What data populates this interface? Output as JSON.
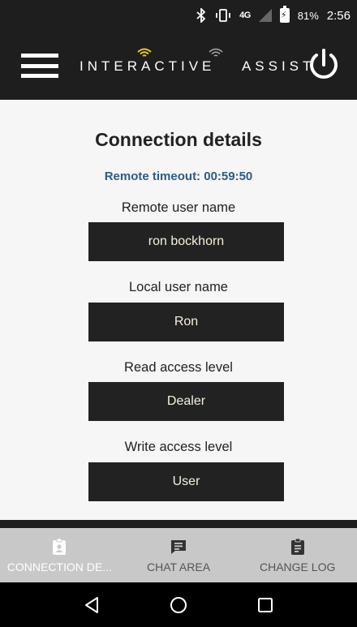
{
  "status_bar": {
    "network": "4G",
    "battery": "81%",
    "time": "2:56"
  },
  "app_bar": {
    "brand_left": "INTERACTIVE",
    "brand_right": "ASSIST",
    "menu_icon": "hamburger-icon",
    "power_icon": "power-icon"
  },
  "main": {
    "title": "Connection details",
    "remote_timeout": "Remote timeout: 00:59:50",
    "fields": [
      {
        "label": "Remote user name",
        "value": "ron bockhorn"
      },
      {
        "label": "Local user name",
        "value": "Ron"
      },
      {
        "label": "Read access level",
        "value": "Dealer"
      },
      {
        "label": "Write access level",
        "value": "User"
      }
    ]
  },
  "bottom_nav": {
    "tabs": [
      {
        "label": "CONNECTION DE...",
        "icon": "badge-icon",
        "active": true
      },
      {
        "label": "CHAT AREA",
        "icon": "chat-icon",
        "active": false
      },
      {
        "label": "CHANGE LOG",
        "icon": "clipboard-icon",
        "active": false
      }
    ]
  },
  "colors": {
    "bar_dark": "#1e1e1e",
    "content_bg": "#f6f6f6",
    "accent_timeout": "#2e5b85",
    "wifi_accent": "#e8c81a",
    "field_box": "#222222"
  }
}
